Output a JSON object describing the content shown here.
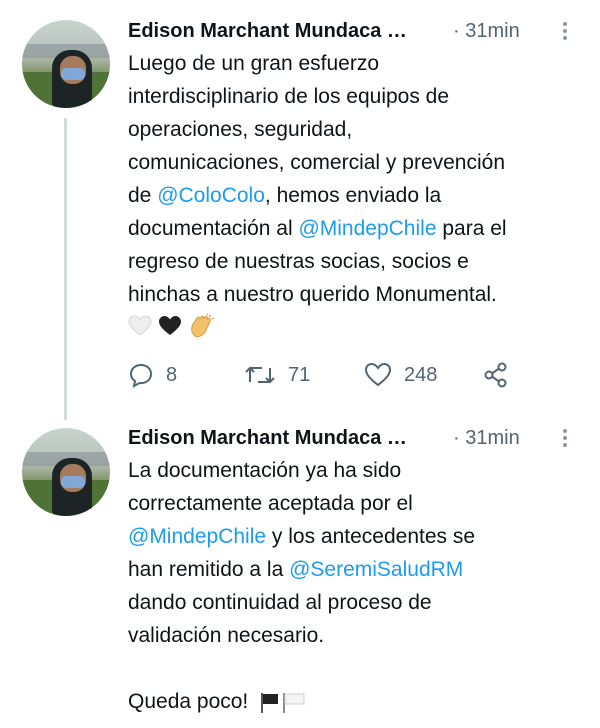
{
  "tweets": [
    {
      "author_name": "Edison Marchant Mundaca …",
      "time": "· 31min",
      "lines": [
        [
          "Luego de un gran esfuerzo",
          "",
          ""
        ],
        [
          "interdisciplinario de los equipos de",
          "",
          ""
        ],
        [
          "operaciones, seguridad,",
          "",
          ""
        ],
        [
          "comunicaciones, comercial y prevención",
          "",
          ""
        ],
        [
          "de ",
          "@ColoColo",
          ", hemos enviado la"
        ],
        [
          "documentación al ",
          "@MindepChile",
          " para el"
        ],
        [
          "regreso de nuestras socias, socios e",
          "",
          ""
        ],
        [
          "hinchas a nuestro querido Monumental.",
          "",
          ""
        ]
      ],
      "emoji_icons": [
        "white-heart-icon",
        "black-heart-icon",
        "clapping-hands-icon"
      ],
      "counts": {
        "replies": "8",
        "retweets": "71",
        "likes": "248"
      }
    },
    {
      "author_name": "Edison Marchant Mundaca …",
      "time": "· 31min",
      "lines": [
        [
          "La documentación ya ha sido",
          "",
          ""
        ],
        [
          "correctamente aceptada por el",
          "",
          ""
        ],
        [
          "",
          "@MindepChile",
          " y los antecedentes se"
        ],
        [
          "han remitido a la ",
          "@SeremiSaludRM",
          ""
        ],
        [
          "dando continuidad al proceso de",
          "",
          ""
        ],
        [
          "validación necesario.",
          "",
          ""
        ],
        [
          "",
          "",
          ""
        ],
        [
          "Queda poco! ",
          "",
          ""
        ]
      ],
      "emoji_icons": [
        "black-flag-icon",
        "white-flag-icon"
      ]
    }
  ],
  "colors": {
    "text": "#0f1419",
    "muted": "#536471",
    "link": "#1d9bf0",
    "thread_line": "#cfd9de"
  }
}
